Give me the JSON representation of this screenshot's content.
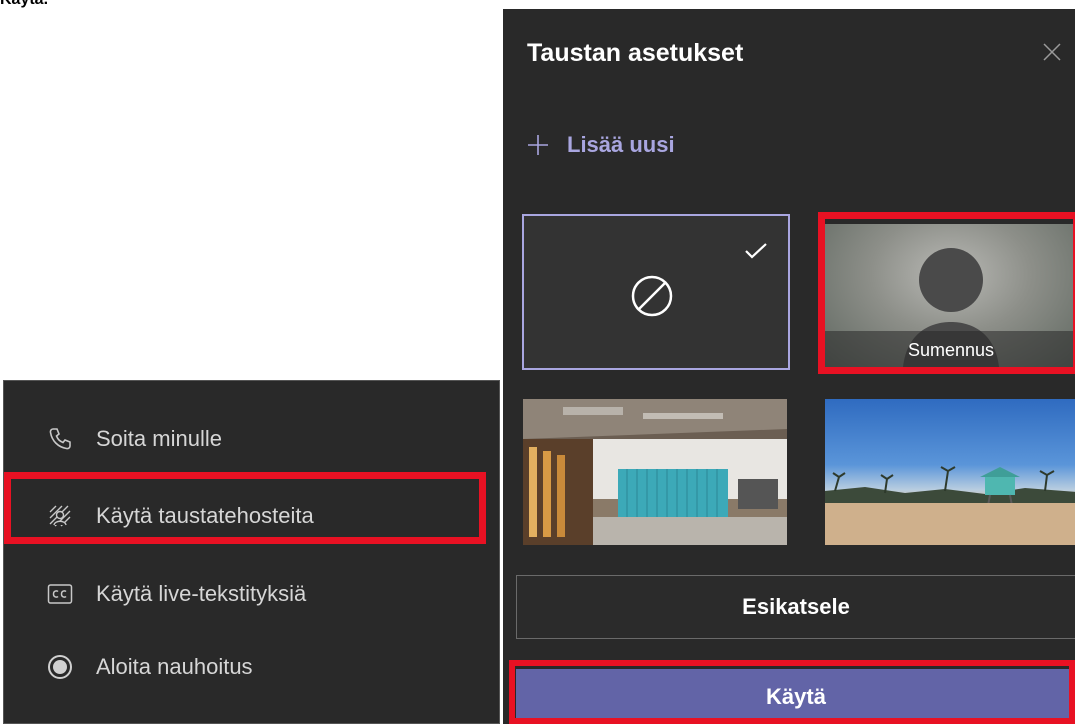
{
  "caption": "Käytä.",
  "menu": {
    "items": [
      {
        "label": "Soita minulle",
        "icon": "phone-icon"
      },
      {
        "label": "Käytä taustatehosteita",
        "icon": "background-effects-icon"
      },
      {
        "label": "Käytä live-tekstityksiä",
        "icon": "cc-icon"
      },
      {
        "label": "Aloita nauhoitus",
        "icon": "record-icon"
      }
    ]
  },
  "panel": {
    "title": "Taustan asetukset",
    "add_new_label": "Lisää uusi",
    "blur_label": "Sumennus",
    "preview_label": "Esikatsele",
    "apply_label": "Käytä"
  },
  "colors": {
    "highlight": "#e81123",
    "accent": "#6264a7",
    "accent_light": "#a9a6e0",
    "panel_bg": "#292929"
  }
}
